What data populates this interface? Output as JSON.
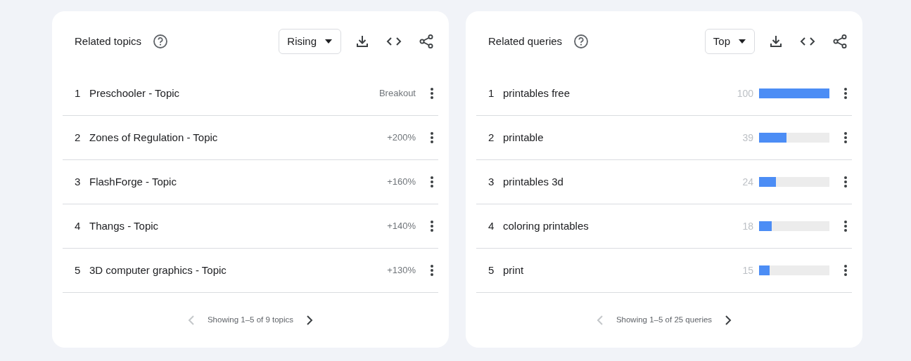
{
  "panels": [
    {
      "title": "Related topics",
      "kind": "text",
      "dropdown": {
        "value": "Rising"
      },
      "items": [
        {
          "rank": "1",
          "label": "Preschooler - Topic",
          "value": "Breakout"
        },
        {
          "rank": "2",
          "label": "Zones of Regulation - Topic",
          "value": "+200%"
        },
        {
          "rank": "3",
          "label": "FlashForge - Topic",
          "value": "+160%"
        },
        {
          "rank": "4",
          "label": "Thangs - Topic",
          "value": "+140%"
        },
        {
          "rank": "5",
          "label": "3D computer graphics - Topic",
          "value": "+130%"
        }
      ],
      "pagination": {
        "text": "Showing 1–5 of 9 topics",
        "prev_disabled": true,
        "next_disabled": false
      }
    },
    {
      "title": "Related queries",
      "kind": "bar",
      "dropdown": {
        "value": "Top"
      },
      "items": [
        {
          "rank": "1",
          "label": "printables free",
          "value": "100",
          "level": 1.0
        },
        {
          "rank": "2",
          "label": "printable",
          "value": "39",
          "level": 0.39
        },
        {
          "rank": "3",
          "label": "printables 3d",
          "value": "24",
          "level": 0.24
        },
        {
          "rank": "4",
          "label": "coloring printables",
          "value": "18",
          "level": 0.18
        },
        {
          "rank": "5",
          "label": "print",
          "value": "15",
          "level": 0.15
        }
      ],
      "pagination": {
        "text": "Showing 1–5 of 25 queries",
        "prev_disabled": true,
        "next_disabled": false
      }
    }
  ]
}
